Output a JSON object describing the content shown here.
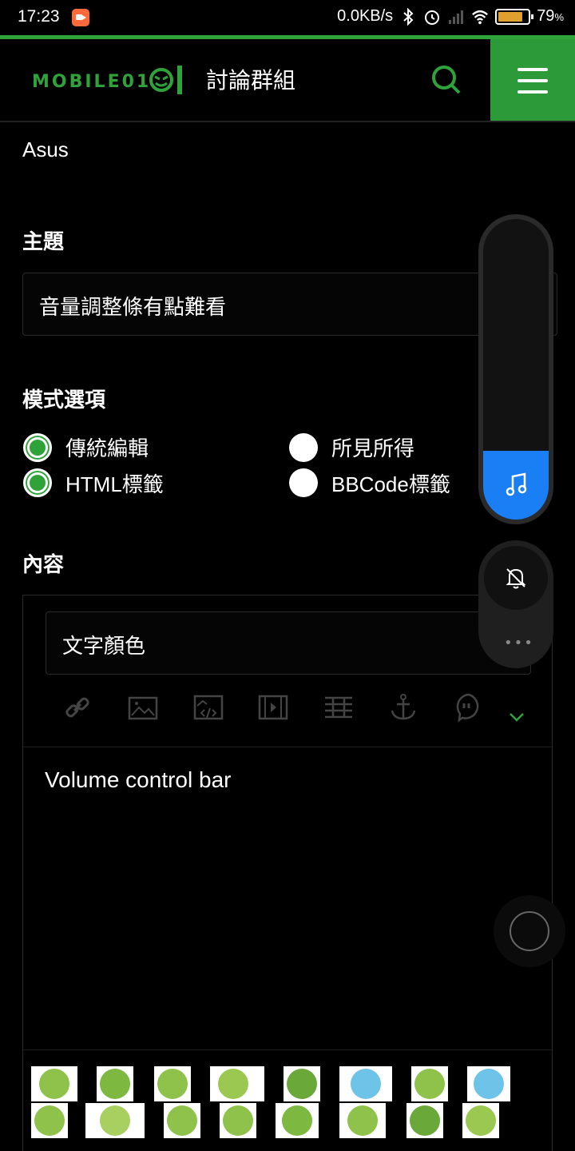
{
  "status_bar": {
    "time": "17:23",
    "net_speed": "0.0KB/s",
    "battery_pct": "79",
    "battery_unit": "%"
  },
  "header": {
    "logo_text": "MOBILE01",
    "title": "討論群組"
  },
  "form": {
    "brand": "Asus",
    "subject_label": "主題",
    "subject_value": "音量調整條有點難看",
    "mode_label": "模式選項",
    "modes": [
      {
        "label": "傳統編輯",
        "selected": true
      },
      {
        "label": "所見所得",
        "selected": false
      },
      {
        "label": "HTML標籤",
        "selected": true
      },
      {
        "label": "BBCode標籤",
        "selected": false
      }
    ],
    "content_label": "內容",
    "text_color_label": "文字顏色",
    "body_text": "Volume control bar"
  },
  "toolbar_icons": [
    "link-icon",
    "image-icon",
    "image-code-icon",
    "video-icon",
    "table-icon",
    "anchor-icon",
    "quote-icon",
    "chevron-down-icon"
  ],
  "volume": {
    "level": 0.23,
    "accent": "#1a7ef5"
  },
  "colors": {
    "brand_green": "#2fa33a",
    "background": "#000000"
  }
}
